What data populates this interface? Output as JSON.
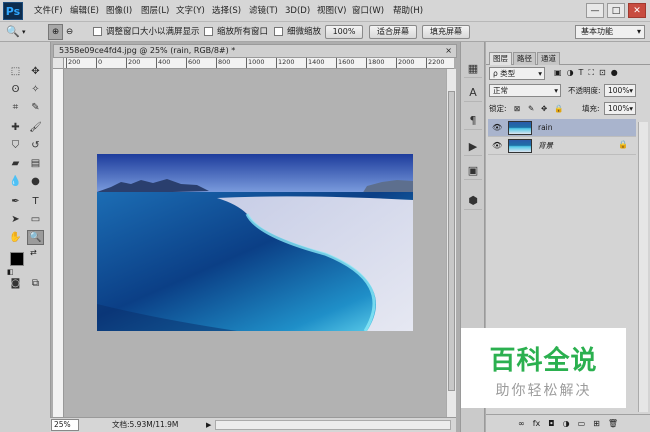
{
  "app": {
    "logo": "Ps"
  },
  "menu": [
    "文件(F)",
    "编辑(E)",
    "图像(I)",
    "图层(L)",
    "文字(Y)",
    "选择(S)",
    "滤镜(T)",
    "3D(D)",
    "视图(V)",
    "窗口(W)",
    "帮助(H)"
  ],
  "window_controls": {
    "min": "—",
    "max": "□",
    "close": "✕"
  },
  "options": {
    "resize_windows": "调整窗口大小以满屏显示",
    "zoom_all": "缩放所有窗口",
    "scrubby_zoom": "细微缩放",
    "actual_pixels": "100%",
    "fit_screen": "适合屏幕",
    "fill_screen": "填充屏幕",
    "workspace": "基本功能"
  },
  "document": {
    "tab_title": "5358e09ce4fd4.jpg @ 25% (rain, RGB/8#) *",
    "close": "×",
    "ruler_ticks": [
      "200",
      "0",
      "200",
      "400",
      "600",
      "800",
      "1000",
      "1200",
      "1400",
      "1600",
      "1800",
      "2000",
      "2200"
    ],
    "zoom": "25%",
    "doc_info": "文档:5.93M/11.9M"
  },
  "panel": {
    "tabs": [
      "图层",
      "路径",
      "通道"
    ],
    "filter_kind": "ρ 类型",
    "blend_mode": "正常",
    "opacity_label": "不透明度:",
    "opacity_value": "100%",
    "lock_label": "锁定:",
    "fill_label": "填充:",
    "fill_value": "100%",
    "layers": [
      {
        "name": "rain",
        "visible": true,
        "selected": true
      },
      {
        "name": "背景",
        "visible": true,
        "selected": false,
        "locked": true
      }
    ],
    "bottom_icons": [
      "link-icon",
      "fx-icon",
      "mask-icon",
      "adjustment-icon",
      "group-icon",
      "new-layer-icon",
      "trash-icon"
    ],
    "bottom_labels": [
      "∞",
      "fx",
      "◘",
      "◑",
      "▭",
      "⊞",
      "🗑"
    ]
  },
  "watermark": {
    "title": "百科全说",
    "subtitle": "助你轻松解决"
  }
}
